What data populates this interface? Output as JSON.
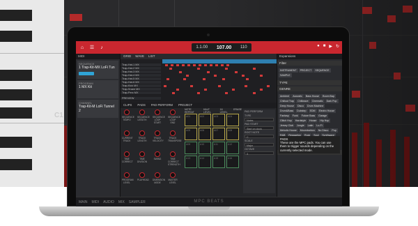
{
  "background": {
    "octave_label": "C1"
  },
  "brand": {
    "text": "MPC BEATS"
  },
  "toolbar": {
    "tempo_left": "1.1.00",
    "tempo_value": "107.00",
    "tempo_right": "110",
    "icons": [
      "home-icon",
      "menu-icon",
      "midi-icon"
    ]
  },
  "left_panel": {
    "header": "MIDI",
    "tracks": [
      {
        "group": "SEQUENCE",
        "name": "1 Trap-Kit-MX LoFi Tun",
        "sub": ""
      },
      {
        "group": "PROGRAM",
        "name": "1 MX Kit",
        "sub": ""
      },
      {
        "group": "",
        "name": "Trap-Kit-M LoFi Tunnel 2",
        "sub": "CHANNEL"
      }
    ]
  },
  "sequencer": {
    "tabs": [
      "GRID",
      "WAVE",
      "LIST"
    ],
    "rows": [
      "Trap-Hat-1 MX",
      "Trap-Hat-2 MX",
      "Trap-Hat-3 MX",
      "Trap-Hat-4 MX",
      "Trap-Hat-5 MX",
      "Trap-Hat-6 MX",
      "Trap-Kick MX",
      "Trap-Snare MX",
      "Trap-Perc MX",
      "PREVIEW"
    ]
  },
  "pad_section": {
    "tabs": [
      "CLIPS",
      "PADS",
      "PAD PERFORM",
      "PROJECT"
    ],
    "knob_labels": [
      "SEQUENCE TEMPO",
      "SEQUENCE LENGTH",
      "SEQUENCE LOOP START",
      "SEQUENCE LOOP END",
      "CURRENT TRACK",
      "TRACK LENGTH",
      "TRACK VELOCITY",
      "TRACK TRANSPOSE",
      "TIME CORRECT",
      "TIME DIVISION",
      "SWING",
      "TIME CORRECT STRENGTH",
      "PROGRAM LEVEL",
      "PLAYHEAD",
      "DIMENSION MODE",
      "MASTER LEVEL"
    ],
    "pad_header": [
      "NOTE REPEAT",
      "HALF LEVEL",
      "16 LEVEL",
      "ERASE"
    ],
    "pad_labels": [
      "A01",
      "A02",
      "A03",
      "A04",
      "A05",
      "A06",
      "A07",
      "A08",
      "A09",
      "A10",
      "A11",
      "A12",
      "A13",
      "A14",
      "A15",
      "A16"
    ]
  },
  "properties": {
    "title": "PAD PERFORM",
    "fields": [
      {
        "label": "TYPE",
        "value": "Notes"
      },
      {
        "label": "PAD START",
        "value": "Start on clock"
      },
      {
        "label": "ROOT NOTE",
        "value": "C"
      },
      {
        "label": "SCALE",
        "value": "Major"
      },
      {
        "label": "OCTAVE",
        "value": "3"
      }
    ]
  },
  "browser": {
    "header": "Expansions",
    "filter_label": "Filter",
    "columns": [
      "INSTRUMENT",
      "PROJECT",
      "SEQUENCE",
      "SAMPLE"
    ],
    "type_label": "TYPE",
    "genre_label": "GENRE",
    "genres": [
      "Ambient",
      "Acoustic",
      "Bass House",
      "Boom Bap",
      "Chillout Trap",
      "Chillwave",
      "Cinematic",
      "Dark Pop",
      "Deep House",
      "Disco",
      "Drum Machine",
      "Drum&Bass",
      "Dubstep",
      "EDM",
      "Electro House",
      "Fantasy",
      "Funk",
      "Future Bass",
      "Garage",
      "Glitch Hop",
      "Hardstyle",
      "House",
      "Hip Hop",
      "Jersey Club",
      "Jungle",
      "Latin",
      "Lo-Fi",
      "Melodic House",
      "Moombahton",
      "Nu Disco",
      "Pop",
      "R&B",
      "Reggaeton",
      "Rock",
      "Soul",
      "Synthwave",
      "Tech House",
      "Techno",
      "Trap",
      "Trap Soul",
      "UK Garage",
      "Vintage Kits",
      "Vocal"
    ],
    "instrument_label": "INSTRUMENT",
    "info_title": "PADS",
    "info_text": "These are the MPC pads. You can use them to trigger sounds depending on the currently selected mode."
  },
  "bottom_bar": {
    "items": [
      "MAIN",
      "MIDI",
      "AUDIO",
      "MIX",
      "SAMPLER"
    ]
  }
}
